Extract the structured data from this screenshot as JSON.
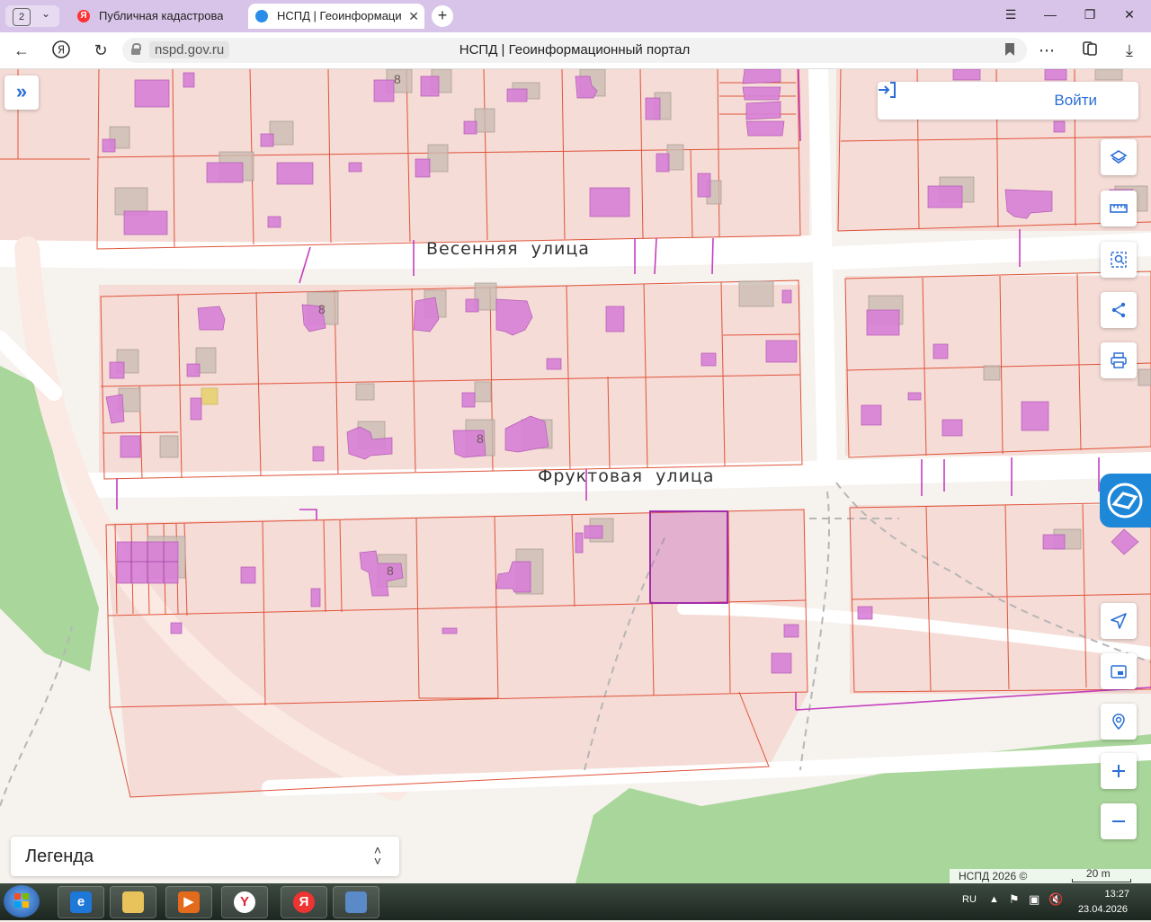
{
  "browser": {
    "tab_count": "2",
    "tabs": [
      {
        "title": "Публичная кадастровая к",
        "favicon": "yandex-icon",
        "favicon_text": "Я"
      },
      {
        "title": "НСПД | Геоинформаци",
        "favicon": "nspd-icon"
      }
    ],
    "url_domain": "nspd.gov.ru",
    "page_title": "НСПД | Геоинформационный портал"
  },
  "map": {
    "streets": [
      {
        "name": "Весенняя  улица"
      },
      {
        "name": "Фруктовая  улица"
      }
    ],
    "house_numbers": [
      "8",
      "8",
      "8",
      "8"
    ],
    "login_label": "Войти",
    "tools": [
      "layers-icon",
      "ruler-icon",
      "area-select-icon",
      "share-icon",
      "print-icon",
      "locate-icon",
      "picture-in-picture-icon",
      "search-location-icon",
      "zoom-in-icon",
      "zoom-out-icon"
    ],
    "legend_label": "Легенда",
    "attribution": "НСПД 2026 ©",
    "scale_label": "20 m",
    "colors": {
      "parcel_fill": "#f5dcd6",
      "parcel_border": "#e0533a",
      "building": "#d77fd7",
      "selected_parcel": "#b84fc0",
      "road": "#ffffff",
      "forest": "#a9d69a",
      "accent": "#2b6fd6"
    }
  },
  "taskbar": {
    "language": "RU",
    "time": "13:27",
    "date": "23.04.2026"
  }
}
